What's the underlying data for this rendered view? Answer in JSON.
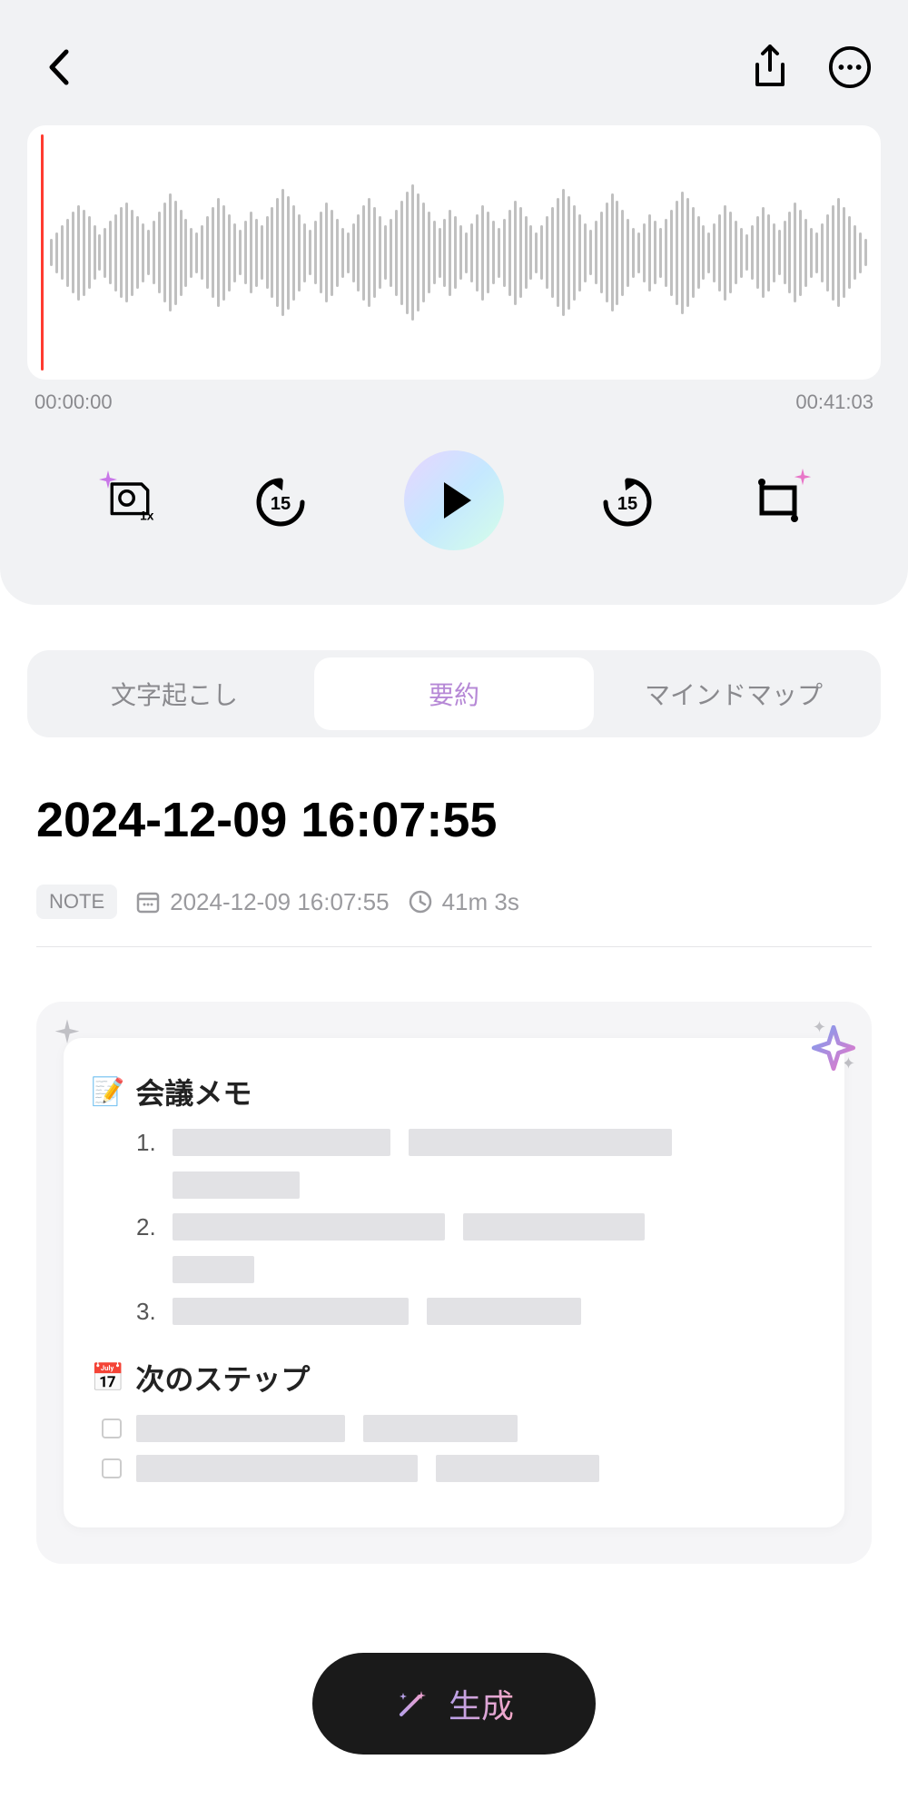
{
  "audio": {
    "start_time": "00:00:00",
    "end_time": "00:41:03"
  },
  "tabs": {
    "transcription": "文字起こし",
    "summary": "要約",
    "mindmap": "マインドマップ"
  },
  "title": "2024-12-09 16:07:55",
  "meta": {
    "note_badge": "NOTE",
    "datetime": "2024-12-09 16:07:55",
    "duration": "41m 3s"
  },
  "summary": {
    "meeting_memo_label": "会議メモ",
    "meeting_memo_icon": "📝",
    "items": [
      "1.",
      "2.",
      "3."
    ],
    "next_steps_label": "次のステップ",
    "next_steps_icon": "📅"
  },
  "generate_button": "生成"
}
